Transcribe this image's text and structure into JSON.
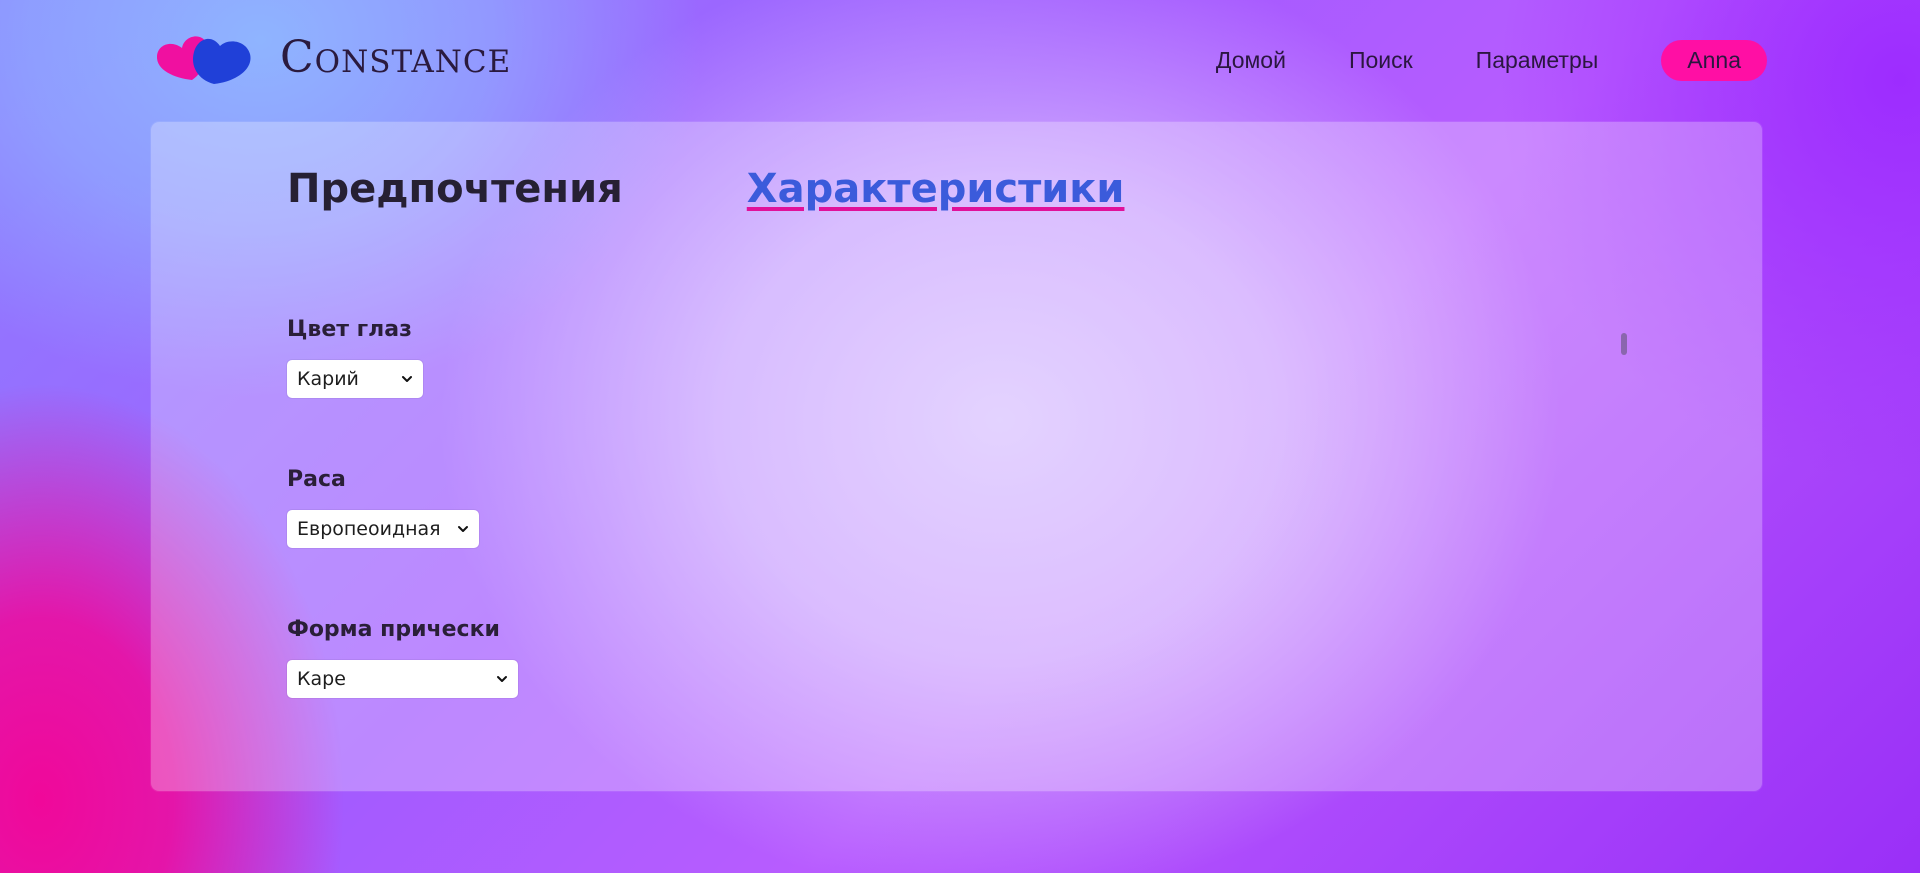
{
  "brand": {
    "name": "Constance",
    "colors": {
      "heart_left": "#f010a0",
      "heart_right": "#2040d8"
    }
  },
  "nav": {
    "items": [
      "Домой",
      "Поиск",
      "Параметры"
    ],
    "user": "Anna",
    "user_pill_color": "#ff0fa4"
  },
  "tabs": {
    "preferences": "Предпочтения",
    "characteristics": "Характеристики",
    "active": "characteristics"
  },
  "fields": {
    "eye_color": {
      "label": "Цвет глаз",
      "value": "Карий"
    },
    "race": {
      "label": "Раса",
      "value": "Европеоидная"
    },
    "hair_shape": {
      "label": "Форма прически",
      "value": "Каре"
    }
  },
  "icons": {
    "logo": "hearts-logo-icon",
    "dropdown": "chevron-down-icon"
  }
}
